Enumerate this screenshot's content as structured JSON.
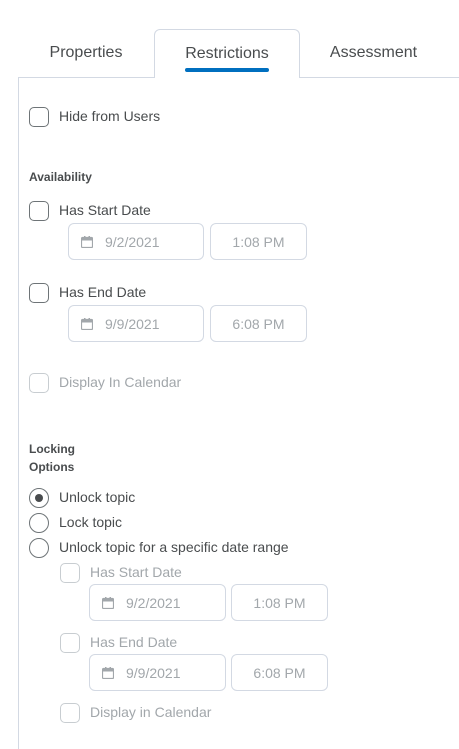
{
  "tabs": [
    {
      "label": "Properties"
    },
    {
      "label": "Restrictions",
      "active": true
    },
    {
      "label": "Assessment"
    }
  ],
  "hide_from_users": {
    "label": "Hide from Users",
    "checked": false
  },
  "availability": {
    "heading": "Availability",
    "start": {
      "label": "Has Start Date",
      "checked": false,
      "date": "9/2/2021",
      "time": "1:08 PM"
    },
    "end": {
      "label": "Has End Date",
      "checked": false,
      "date": "9/9/2021",
      "time": "6:08 PM"
    },
    "display_in_calendar": {
      "label": "Display In Calendar",
      "checked": false,
      "disabled": true
    }
  },
  "locking": {
    "heading_line1": "Locking",
    "heading_line2": "Options",
    "options": [
      {
        "label": "Unlock topic",
        "selected": true
      },
      {
        "label": "Lock topic",
        "selected": false
      },
      {
        "label": "Unlock topic for a specific date range",
        "selected": false
      }
    ],
    "range": {
      "start": {
        "label": "Has Start Date",
        "date": "9/2/2021",
        "time": "1:08 PM"
      },
      "end": {
        "label": "Has End Date",
        "date": "9/9/2021",
        "time": "6:08 PM"
      },
      "display_in_calendar": {
        "label": "Display in Calendar"
      }
    }
  },
  "colors": {
    "accent": "#006fbf",
    "text": "#494c4e",
    "disabled_text": "#a2a7ab",
    "border": "#d3d9e3"
  }
}
